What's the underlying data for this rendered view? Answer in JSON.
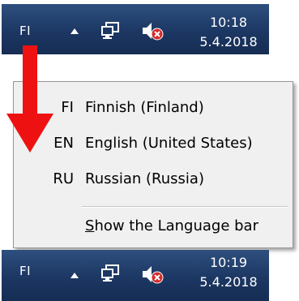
{
  "taskbar_top": {
    "language": "FI",
    "time": "10:18",
    "date": "5.4.2018"
  },
  "taskbar_bottom": {
    "language": "FI",
    "time": "10:19",
    "date": "5.4.2018"
  },
  "language_menu": {
    "items": [
      {
        "code": "FI",
        "name": "Finnish (Finland)"
      },
      {
        "code": "EN",
        "name": "English (United States)"
      },
      {
        "code": "RU",
        "name": "Russian (Russia)"
      }
    ],
    "show_bar_accel": "S",
    "show_bar_rest": "how the Language bar"
  },
  "icons": {
    "network": "network-icon",
    "volume": "volume-muted-icon",
    "tray": "show-hidden-icons-arrow",
    "pointer": "red-down-arrow"
  },
  "colors": {
    "taskbar": "#1c3763",
    "arrow": "#ee1111",
    "menu_background": "#f0f0f0",
    "mute_badge": "#d42a2a"
  }
}
